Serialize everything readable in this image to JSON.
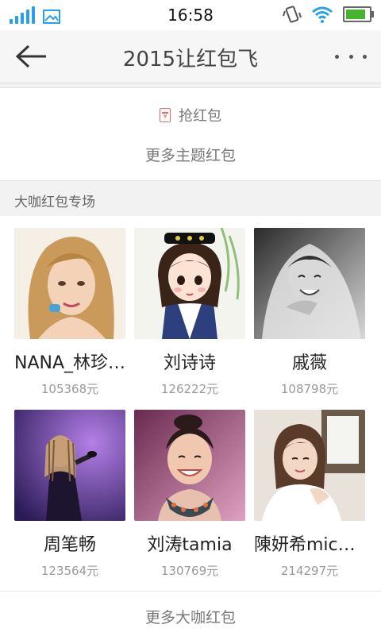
{
  "status_bar": {
    "time": "16:58",
    "icons": [
      "signal-icon",
      "image-notification-icon",
      "vibrate-icon",
      "wifi-icon",
      "battery-icon"
    ],
    "signal_color": "#2aa0e8",
    "battery_color": "#45b52b"
  },
  "nav": {
    "title": "2015让红包飞",
    "back_icon": "back-arrow-icon",
    "more_icon": "more-dots-icon"
  },
  "top_card": {
    "grab_label": "抢红包",
    "grab_icon": "red-envelope-icon",
    "accent": "#e46a5f",
    "more_theme": "更多主题红包"
  },
  "section": {
    "title": "大咖红包专场"
  },
  "celebrities": [
    {
      "name": "NANA_林珍…",
      "amount": "105368元"
    },
    {
      "name": "刘诗诗",
      "amount": "126222元"
    },
    {
      "name": "戚薇",
      "amount": "108798元"
    },
    {
      "name": "周笔畅",
      "amount": "123564元"
    },
    {
      "name": "刘涛tamia",
      "amount": "130769元"
    },
    {
      "name": "陳妍希mich…",
      "amount": "214297元"
    }
  ],
  "footer": {
    "more_label": "更多大咖红包"
  }
}
